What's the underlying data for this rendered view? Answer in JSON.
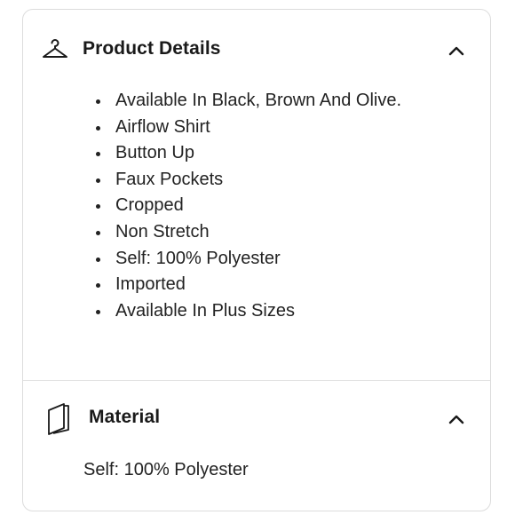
{
  "product_details": {
    "title": "Product Details",
    "icon": "hanger-icon",
    "expanded": true,
    "items": [
      "Available In Black, Brown And Olive.",
      "Airflow Shirt",
      "Button Up",
      "Faux Pockets",
      "Cropped",
      "Non Stretch",
      "Self: 100% Polyester",
      "Imported",
      "Available In Plus Sizes"
    ]
  },
  "material": {
    "title": "Material",
    "icon": "fabric-icon",
    "expanded": true,
    "text": "Self: 100% Polyester"
  },
  "colors": {
    "text": "#1a1a1a",
    "border": "#dcdcdc",
    "background": "#ffffff"
  }
}
